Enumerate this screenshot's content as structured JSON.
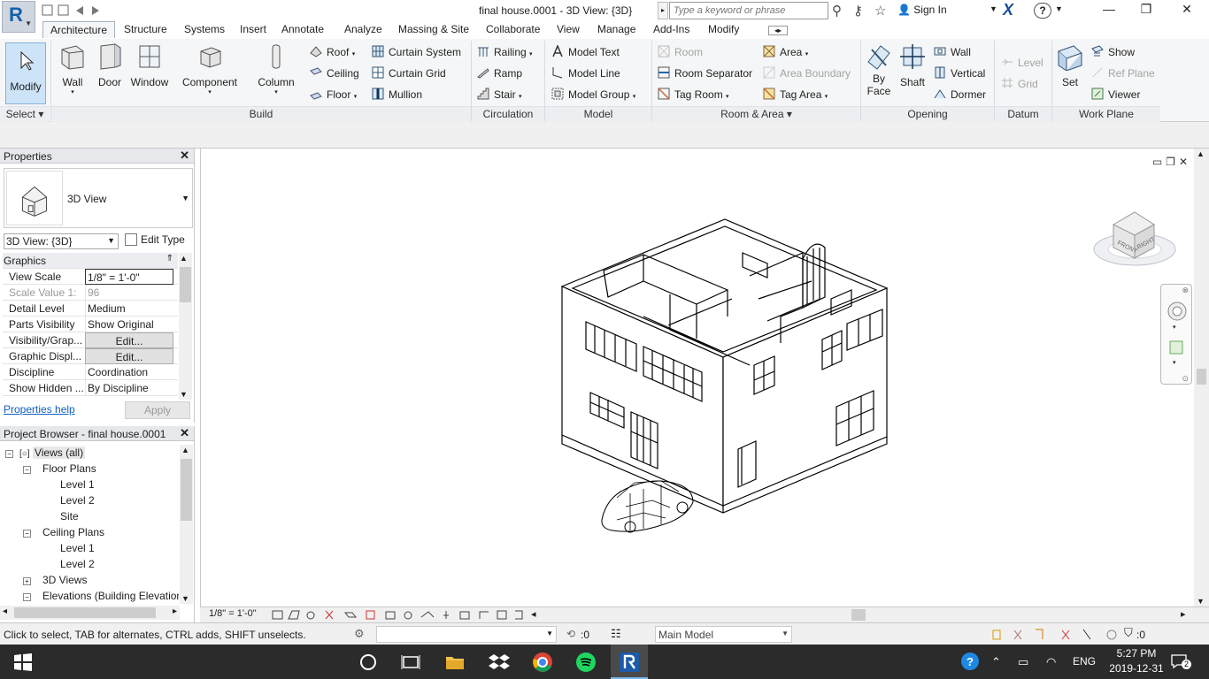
{
  "window": {
    "title": "final house.0001 - 3D View: {3D}",
    "search_placeholder": "Type a keyword or phrase",
    "sign_in": "Sign In",
    "help": "?",
    "minimize": "—",
    "restore": "❐",
    "close": "✕"
  },
  "app_menu": {
    "letter": "R"
  },
  "tabs": [
    "Architecture",
    "Structure",
    "Systems",
    "Insert",
    "Annotate",
    "Analyze",
    "Massing & Site",
    "Collaborate",
    "View",
    "Manage",
    "Add-Ins",
    "Modify"
  ],
  "active_tab": "Architecture",
  "ribbon": {
    "select": {
      "modify": "Modify",
      "select_label": "Select"
    },
    "build": {
      "label": "Build",
      "big": [
        "Wall",
        "Door",
        "Window",
        "Component",
        "Column"
      ],
      "roof": "Roof",
      "ceiling": "Ceiling",
      "floor": "Floor",
      "curtain_system": "Curtain System",
      "curtain_grid": "Curtain Grid",
      "mullion": "Mullion"
    },
    "circulation": {
      "label": "Circulation",
      "railing": "Railing",
      "ramp": "Ramp",
      "stair": "Stair"
    },
    "model": {
      "label": "Model",
      "model_text": "Model  Text",
      "model_line": "Model  Line",
      "model_group": "Model  Group"
    },
    "room_area": {
      "label": "Room & Area",
      "room": "Room",
      "room_separator": "Room  Separator",
      "tag_room": "Tag  Room",
      "area": "Area",
      "area_boundary": "Area  Boundary",
      "tag_area": "Tag  Area"
    },
    "opening": {
      "label": "Opening",
      "by_face_1": "By",
      "by_face_2": "Face",
      "shaft": "Shaft",
      "wall": "Wall",
      "vertical": "Vertical",
      "dormer": "Dormer"
    },
    "datum": {
      "label": "Datum",
      "level": "Level",
      "grid": "Grid"
    },
    "work_plane": {
      "label": "Work Plane",
      "set": "Set",
      "show": "Show",
      "ref_plane": "Ref  Plane",
      "viewer": "Viewer"
    }
  },
  "properties": {
    "title": "Properties",
    "type_name": "3D View",
    "instance_selector": "3D View: {3D}",
    "edit_type": "Edit Type",
    "group": "Graphics",
    "rows": [
      {
        "k": "View Scale",
        "v": "1/8\" = 1'-0\""
      },
      {
        "k": "Scale Value    1:",
        "v": "96"
      },
      {
        "k": "Detail Level",
        "v": "Medium"
      },
      {
        "k": "Parts Visibility",
        "v": "Show Original"
      },
      {
        "k": "Visibility/Grap...",
        "v": "Edit..."
      },
      {
        "k": "Graphic Displ...",
        "v": "Edit..."
      },
      {
        "k": "Discipline",
        "v": "Coordination"
      },
      {
        "k": "Show Hidden ...",
        "v": "By Discipline"
      }
    ],
    "help_link": "Properties help",
    "apply": "Apply"
  },
  "project_browser": {
    "title": "Project Browser - final house.0001",
    "nodes": [
      {
        "label": "Views (all)"
      },
      {
        "label": "Floor Plans"
      },
      {
        "label": "Level 1"
      },
      {
        "label": "Level 2"
      },
      {
        "label": "Site"
      },
      {
        "label": "Ceiling Plans"
      },
      {
        "label": "Level 1"
      },
      {
        "label": "Level 2"
      },
      {
        "label": "3D Views"
      },
      {
        "label": "Elevations (Building Elevation"
      }
    ]
  },
  "viewcube": {
    "front": "FRONT",
    "right": "RIGHT"
  },
  "view_control_bar": {
    "scale": "1/8\" = 1'-0\""
  },
  "status": {
    "text": "Click to select, TAB for alternates, CTRL adds, SHIFT unselects.",
    "selection_count": ":0",
    "active_model": "Main Model",
    "filter_count": ":0"
  },
  "taskbar": {
    "lang": "ENG",
    "time": "5:27 PM",
    "date": "2019-12-31",
    "notifications": "2"
  }
}
